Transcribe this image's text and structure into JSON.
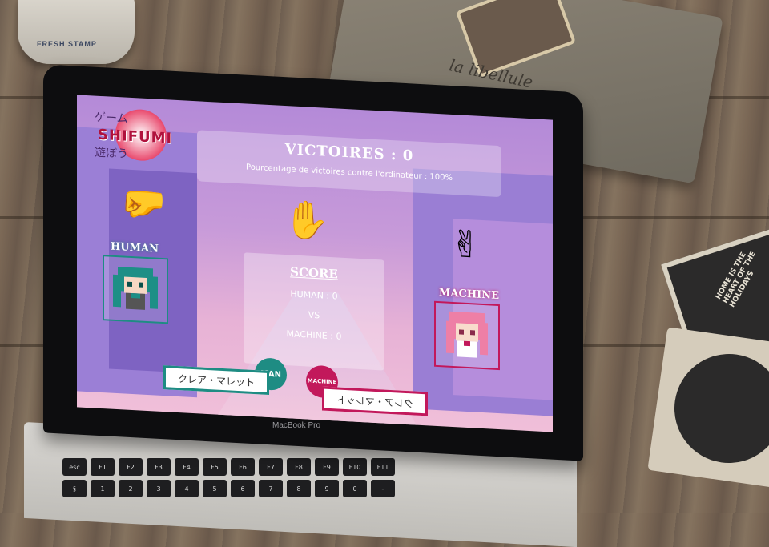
{
  "app": {
    "logo_title": "SHIFUMI",
    "logo_kana_top": "ゲーム",
    "logo_kana_bottom": "遊ぼう"
  },
  "victories": {
    "title": "VICTOIRES : 0",
    "subtitle": "Pourcentage de victoires contre l'ordinateur : 100%"
  },
  "hands": {
    "rock": "🤛",
    "paper": "✋",
    "scissors": "✌"
  },
  "players": {
    "human_label": "HUMAN",
    "machine_label": "MACHINE"
  },
  "score": {
    "title": "SCORE",
    "human": "HUMAN : 0",
    "vs": "VS",
    "machine": "MACHINE : 0"
  },
  "badges": {
    "human": "MAN",
    "machine": "MACHINE"
  },
  "nameplates": {
    "human": "クレア・マレット",
    "machine": "クレア・マレット"
  },
  "device": {
    "brand": "MacBook Pro"
  },
  "props": {
    "pouch_text": "la libellule",
    "coaster_text": "HOME IS THE HEART OF THE HOLIDAYS",
    "jar_label": "FRESH STAMP"
  },
  "keyboard": {
    "row1": [
      "esc",
      "F1",
      "F2",
      "F3",
      "F4",
      "F5",
      "F6",
      "F7",
      "F8",
      "F9",
      "F10",
      "F11"
    ],
    "row2": [
      "§",
      "1",
      "2",
      "3",
      "4",
      "5",
      "6",
      "7",
      "8",
      "9",
      "0",
      "-"
    ]
  },
  "colors": {
    "human_accent": "#1e8c83",
    "machine_accent": "#c2185b",
    "screen_bg": "#c79ad9"
  }
}
